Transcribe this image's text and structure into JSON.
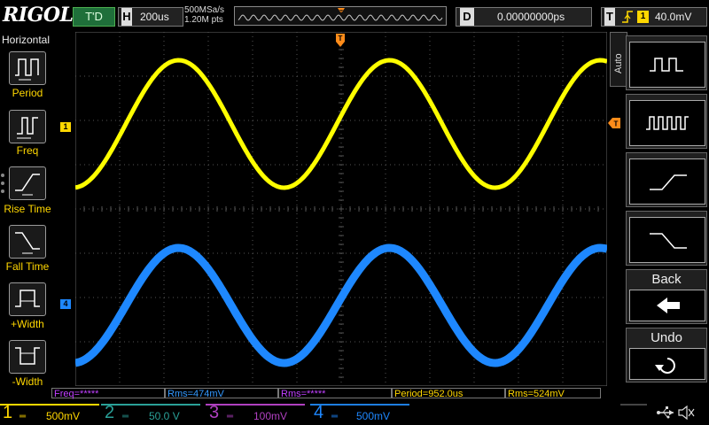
{
  "brand": "RIGOL",
  "top": {
    "run_status": "T'D",
    "horizontal_letter": "H",
    "timebase": "200us",
    "sample_rate": "500MSa/s",
    "memory_depth": "1.20M pts",
    "delay_letter": "D",
    "delay": "0.00000000ps",
    "trigger_letter": "T",
    "trigger_source": "1",
    "trigger_level": "40.0mV"
  },
  "left_menu": {
    "title": "Horizontal",
    "items": [
      {
        "label": "Period"
      },
      {
        "label": "Freq"
      },
      {
        "label": "Rise Time"
      },
      {
        "label": "Fall Time"
      },
      {
        "label": "+Width"
      },
      {
        "label": "-Width"
      }
    ]
  },
  "right_menu": {
    "tab": "Auto",
    "back_label": "Back",
    "undo_label": "Undo"
  },
  "markers": {
    "ch1": "1",
    "ch4": "4",
    "trigger_pos": "T"
  },
  "measurements": [
    {
      "text": "Freq=*****",
      "color": "#c040ff"
    },
    {
      "text": "Rms=474mV",
      "color": "#3399ff"
    },
    {
      "text": "Rms=*****",
      "color": "#c040ff"
    },
    {
      "text": "Period=952.0us",
      "color": "#ffd700"
    },
    {
      "text": "Rms=524mV",
      "color": "#ffd700"
    }
  ],
  "channels": [
    {
      "number": "1",
      "scale": "500mV",
      "color": "#ffd700",
      "active": true
    },
    {
      "number": "2",
      "scale": "50.0 V",
      "color": "#2aa198",
      "active": false
    },
    {
      "number": "3",
      "scale": "100mV",
      "color": "#b040c0",
      "active": false
    },
    {
      "number": "4",
      "scale": "500mV",
      "color": "#1e7ee0",
      "active": true
    }
  ],
  "colors": {
    "ch1": "#ffff00",
    "ch4": "#1e88ff",
    "grid": "#555555",
    "accent": "#ffd700"
  }
}
